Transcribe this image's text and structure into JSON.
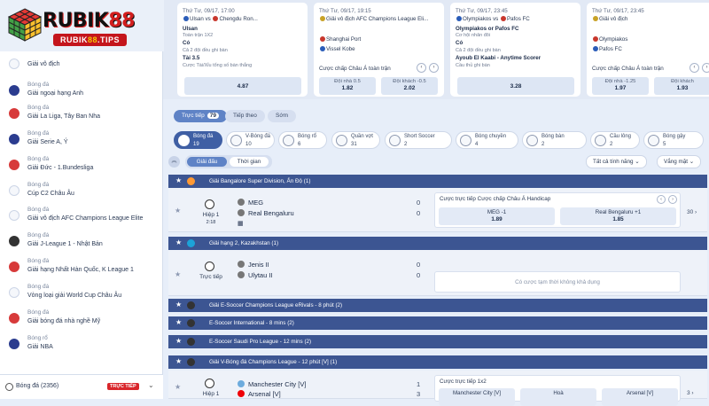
{
  "logo": {
    "main_a": "RUBIK",
    "main_b": "88",
    "sub_a": "RUBIK",
    "sub_b": "88",
    "sub_c": ".TIPS"
  },
  "sidebar": {
    "items": [
      {
        "sport": "",
        "league": "Giải vô địch",
        "icon": "trophy-icon",
        "color": ""
      },
      {
        "sport": "Bóng đá",
        "league": "Giải ngoại hạng Anh",
        "icon": "premier-league-icon",
        "color": "b"
      },
      {
        "sport": "Bóng đá",
        "league": "Giải La Liga, Tây Ban Nha",
        "icon": "laliga-icon",
        "color": "r"
      },
      {
        "sport": "Bóng đá",
        "league": "Giải Serie A, Ý",
        "icon": "serie-a-icon",
        "color": "b"
      },
      {
        "sport": "Bóng đá",
        "league": "Giải Đức - 1.Bundesliga",
        "icon": "bundesliga-icon",
        "color": "r"
      },
      {
        "sport": "Bóng đá",
        "league": "Cúp C2 Châu Âu",
        "icon": "europa-icon",
        "color": ""
      },
      {
        "sport": "Bóng đá",
        "league": "Giải vô địch AFC Champions League Elite",
        "icon": "afc-icon",
        "color": ""
      },
      {
        "sport": "Bóng đá",
        "league": "Giải J-League 1 - Nhật Bản",
        "icon": "jleague-icon",
        "color": "k"
      },
      {
        "sport": "Bóng đá",
        "league": "Giải hạng Nhất Hàn Quốc, K League 1",
        "icon": "kleague-icon",
        "color": "r"
      },
      {
        "sport": "Bóng đá",
        "league": "Vòng loại giải World Cup Châu Âu",
        "icon": "world-cup-icon",
        "color": ""
      },
      {
        "sport": "Bóng đá",
        "league": "Giải bóng đá nhà nghề Mỹ",
        "icon": "mls-icon",
        "color": "r"
      },
      {
        "sport": "Bóng rổ",
        "league": "Giải NBA",
        "icon": "nba-icon",
        "color": "b"
      }
    ],
    "bottom": {
      "label": "Bóng đá  (2356)",
      "live": "TRỰC TIẾP",
      "chevron": "⌄"
    }
  },
  "cards": [
    {
      "date": "Thứ Tư, 09/17, 17:00",
      "home": "Ulsan",
      "vs": "vs",
      "away": "Chengdu Ron...",
      "r1": "Ulsan",
      "r1s": "Toàn trận 1X2",
      "r2": "Có",
      "r2s": "Cả 2 đội đều ghi bàn",
      "r3": "Tài 3.5",
      "r3s": "Cược Tài/Xỉu tổng số bàn thắng",
      "mkt": "",
      "o1l": "",
      "o1v": "4.87",
      "o2l": "",
      "o2v": ""
    },
    {
      "date": "Thứ Tư, 09/17, 19:15",
      "home": "Giải vô địch AFC Champions League Eli...",
      "vs": "",
      "away": "",
      "r1": "Shanghai Port",
      "r1s": "",
      "r2": "Vissel Kobe",
      "r2s": "",
      "r3": "",
      "r3s": "",
      "mkt": "Cược chấp Châu Á toàn trận",
      "o1l": "Đội nhà 0.5",
      "o1v": "1.82",
      "o2l": "Đội khách -0.5",
      "o2v": "2.02"
    },
    {
      "date": "Thứ Tư, 09/17, 23:45",
      "home": "Olympiakos",
      "vs": "vs",
      "away": "Pafos FC",
      "r1": "Olympiakos or Pafos FC",
      "r1s": "Cơ hội nhân đôi",
      "r2": "Có",
      "r2s": "Cả 2 đội đều ghi bàn",
      "r3": "Ayoub El Kaabi - Anytime Scorer",
      "r3s": "Cầu thủ ghi bàn",
      "mkt": "",
      "o1l": "",
      "o1v": "3.28",
      "o2l": "",
      "o2v": ""
    },
    {
      "date": "Thứ Tư, 09/17, 23:45",
      "home": "Giải vô địch",
      "vs": "",
      "away": "",
      "r1": "Olympiakos",
      "r1s": "",
      "r2": "Pafos FC",
      "r2s": "",
      "r3": "",
      "r3s": "",
      "mkt": "Cược chấp Châu Á toàn trận",
      "o1l": "Đội nhà -1.25",
      "o1v": "1.97",
      "o2l": "Đội khách",
      "o2v": "1.93"
    }
  ],
  "filters": {
    "live": "Trực tiếp",
    "live_count": "79",
    "next": "Tiếp theo",
    "soon": "Sớm"
  },
  "sports": [
    {
      "name": "Bóng đá",
      "count": "19"
    },
    {
      "name": "V-Bóng đá",
      "count": "10"
    },
    {
      "name": "Bóng rổ",
      "count": "6"
    },
    {
      "name": "Quần vợt",
      "count": "31"
    },
    {
      "name": "Short Soccer",
      "count": "2"
    },
    {
      "name": "Bóng chuyền",
      "count": "4"
    },
    {
      "name": "Bóng bàn",
      "count": "2"
    },
    {
      "name": "Cầu lông",
      "count": "2"
    },
    {
      "name": "Bóng gậy",
      "count": "5"
    }
  ],
  "toolbar": {
    "collapse": "︽",
    "seg_a": "Giải đấu",
    "seg_b": "Thời gian",
    "all": "Tất cả tính năng  ⌄",
    "sort": "Vắng mặt  ⌄"
  },
  "leagues": [
    {
      "name": "Giải Bangalore Super Division, Ấn Độ (1)"
    },
    {
      "name": "Giải hạng 2, Kazakhstan (1)"
    },
    {
      "name": "Giải E-Soccer Champions League eRivals - 8 phút (2)"
    },
    {
      "name": "E-Soccer International - 8 mins (2)"
    },
    {
      "name": "E-Soccer Saudi Pro League - 12 mins (2)"
    },
    {
      "name": "Giải V-Bóng đá Champions League - 12 phút [V] (1)"
    }
  ],
  "matches": [
    {
      "period": "Hiệp 1",
      "time": "2:18",
      "home": "MEG",
      "away": "Real Bengaluru",
      "hs": "0",
      "as": "0",
      "mkt": "Cược trực tiếp Cược chấp Châu Á Handicap",
      "o1l": "MEG -1",
      "o1v": "1.89",
      "o2l": "Real Bengaluru +1",
      "o2v": "1.85",
      "more": "30  ›"
    },
    {
      "period": "Trực tiếp",
      "time": "",
      "home": "Jenis II",
      "away": "Ulytau II",
      "hs": "0",
      "as": "0",
      "empty": "Có cược tạm thời không khả dụng"
    },
    {
      "period": "Hiệp 1",
      "time": "",
      "home": "Manchester City [V]",
      "away": "Arsenal [V]",
      "hs": "1",
      "as": "3",
      "mkt": "Cược trực tiếp 1x2",
      "o1l": "Manchester City [V]",
      "o2l": "Hoà",
      "o3l": "Arsenal [V]",
      "more": "3  ›"
    }
  ]
}
